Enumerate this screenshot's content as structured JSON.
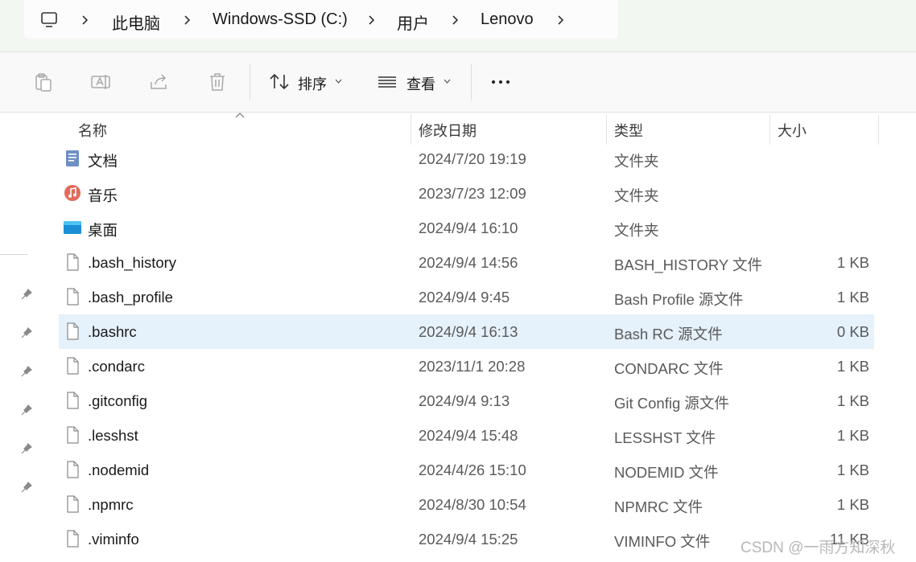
{
  "breadcrumb": {
    "items": [
      "此电脑",
      "Windows-SSD (C:)",
      "用户",
      "Lenovo"
    ]
  },
  "toolbar": {
    "copy_icon": "clipboard-icon",
    "rename_icon": "rename-icon",
    "share_icon": "share-icon",
    "delete_icon": "trash-icon",
    "sort_label": "排序",
    "view_label": "查看",
    "more_icon": "more-icon"
  },
  "columns": {
    "name": "名称",
    "date": "修改日期",
    "type": "类型",
    "size": "大小"
  },
  "files": [
    {
      "name": "文档",
      "date": "2024/7/20 19:19",
      "type": "文件夹",
      "size": "",
      "icon": "documents-folder-icon"
    },
    {
      "name": "音乐",
      "date": "2023/7/23 12:09",
      "type": "文件夹",
      "size": "",
      "icon": "music-folder-icon"
    },
    {
      "name": "桌面",
      "date": "2024/9/4 16:10",
      "type": "文件夹",
      "size": "",
      "icon": "desktop-folder-icon"
    },
    {
      "name": ".bash_history",
      "date": "2024/9/4 14:56",
      "type": "BASH_HISTORY 文件",
      "size": "1 KB",
      "icon": "file-icon"
    },
    {
      "name": ".bash_profile",
      "date": "2024/9/4 9:45",
      "type": "Bash Profile 源文件",
      "size": "1 KB",
      "icon": "file-icon"
    },
    {
      "name": ".bashrc",
      "date": "2024/9/4 16:13",
      "type": "Bash RC 源文件",
      "size": "0 KB",
      "icon": "file-icon",
      "selected": true
    },
    {
      "name": ".condarc",
      "date": "2023/11/1 20:28",
      "type": "CONDARC 文件",
      "size": "1 KB",
      "icon": "file-icon"
    },
    {
      "name": ".gitconfig",
      "date": "2024/9/4 9:13",
      "type": "Git Config 源文件",
      "size": "1 KB",
      "icon": "file-icon"
    },
    {
      "name": ".lesshst",
      "date": "2024/9/4 15:48",
      "type": "LESSHST 文件",
      "size": "1 KB",
      "icon": "file-icon"
    },
    {
      "name": ".nodemid",
      "date": "2024/4/26 15:10",
      "type": "NODEMID 文件",
      "size": "1 KB",
      "icon": "file-icon"
    },
    {
      "name": ".npmrc",
      "date": "2024/8/30 10:54",
      "type": "NPMRC 文件",
      "size": "1 KB",
      "icon": "file-icon"
    },
    {
      "name": ".viminfo",
      "date": "2024/9/4 15:25",
      "type": "VIMINFO 文件",
      "size": "11 KB",
      "icon": "file-icon"
    }
  ],
  "colors": {
    "selected_row": "#e5f1fb",
    "address_bg": "#f3f7f1"
  },
  "watermark": "CSDN @一雨方知深秋"
}
